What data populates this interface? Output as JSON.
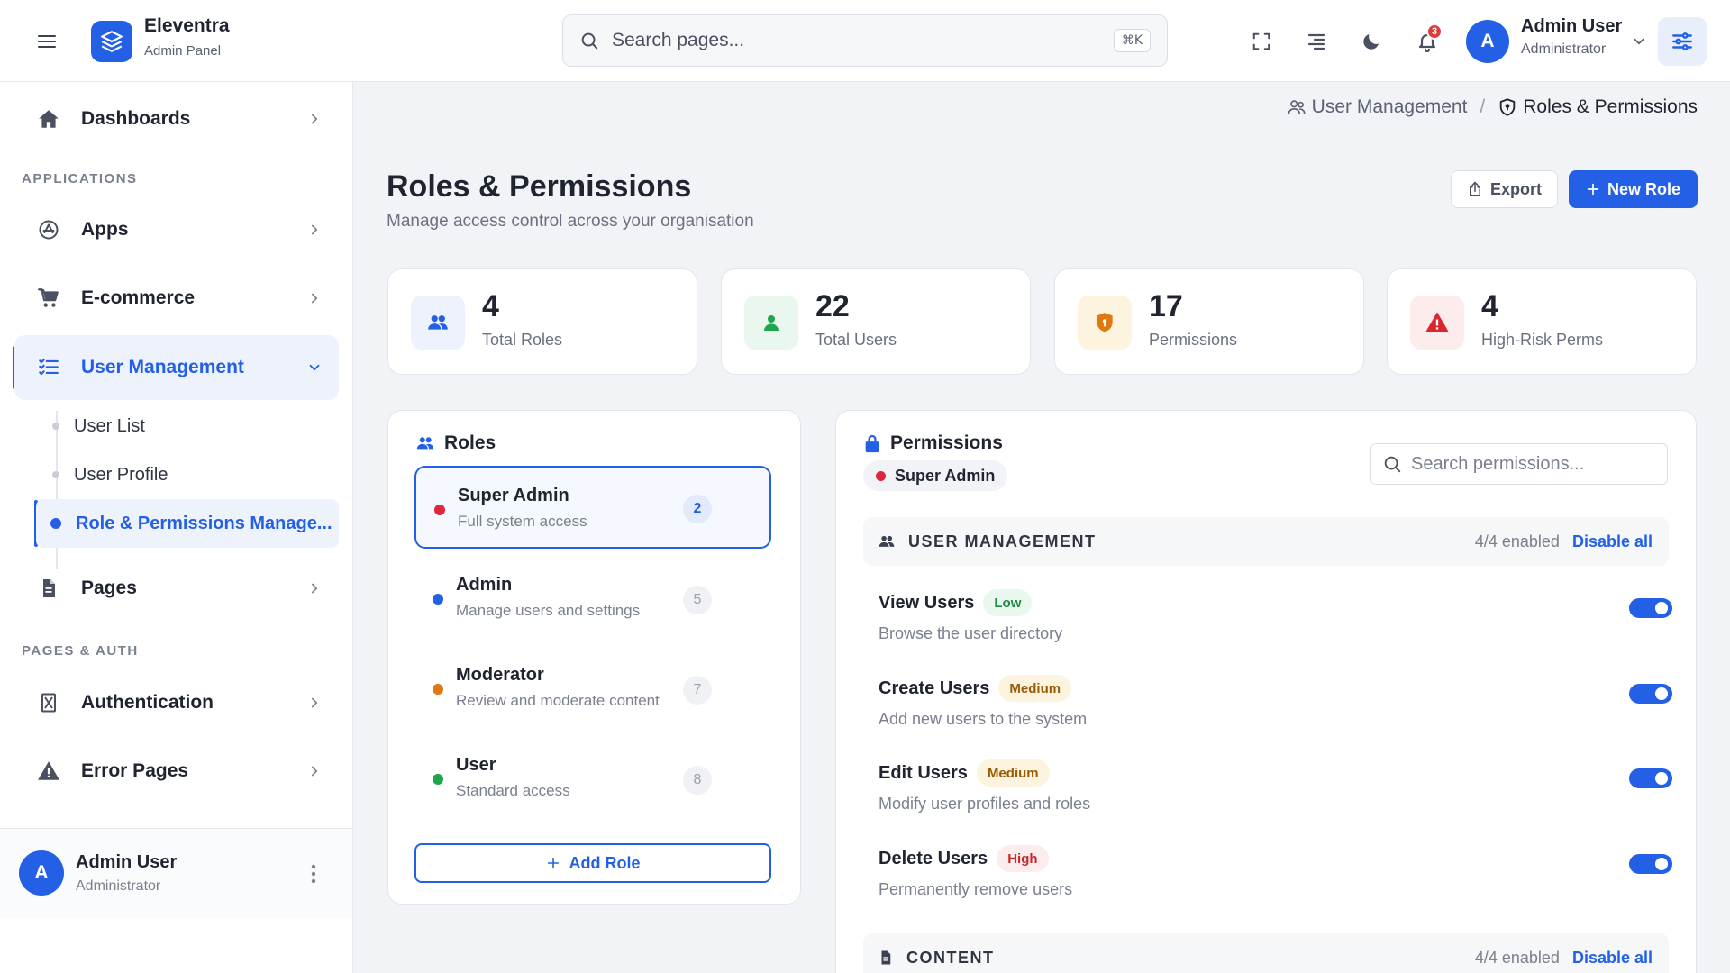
{
  "header": {
    "brand_name": "Eleventra",
    "brand_sub": "Admin Panel",
    "search_placeholder": "Search pages...",
    "search_shortcut": "⌘K",
    "notification_count": "3",
    "user_initial": "A",
    "user_name": "Admin User",
    "user_role": "Administrator"
  },
  "sidebar": {
    "dashboards": "Dashboards",
    "section_applications": "APPLICATIONS",
    "apps": "Apps",
    "ecommerce": "E-commerce",
    "user_management": "User Management",
    "sub_user_list": "User List",
    "sub_user_profile": "User Profile",
    "sub_roles": "Role & Permissions Manage...",
    "pages": "Pages",
    "section_pages_auth": "PAGES & AUTH",
    "authentication": "Authentication",
    "error_pages": "Error Pages",
    "footer_initial": "A",
    "footer_name": "Admin User",
    "footer_role": "Administrator"
  },
  "breadcrumb": {
    "parent": "User Management",
    "separator": "/",
    "current": "Roles & Permissions"
  },
  "page": {
    "title": "Roles & Permissions",
    "subtitle": "Manage access control across your organisation",
    "export_label": "Export",
    "new_role_label": "New Role"
  },
  "stats": [
    {
      "value": "4",
      "label": "Total Roles"
    },
    {
      "value": "22",
      "label": "Total Users"
    },
    {
      "value": "17",
      "label": "Permissions"
    },
    {
      "value": "4",
      "label": "High-Risk Perms"
    }
  ],
  "roles_panel": {
    "title": "Roles",
    "add_label": "Add Role",
    "items": [
      {
        "name": "Super Admin",
        "desc": "Full system access",
        "count": "2",
        "color": "#e0263f"
      },
      {
        "name": "Admin",
        "desc": "Manage users and settings",
        "count": "5",
        "color": "#2360e6"
      },
      {
        "name": "Moderator",
        "desc": "Review and moderate content",
        "count": "7",
        "color": "#e07a10"
      },
      {
        "name": "User",
        "desc": "Standard access",
        "count": "8",
        "color": "#1fa64a"
      }
    ]
  },
  "permissions_panel": {
    "title": "Permissions",
    "selected_role": "Super Admin",
    "search_placeholder": "Search permissions...",
    "groups": [
      {
        "title": "USER MANAGEMENT",
        "count": "4/4 enabled",
        "toggle_label": "Disable all",
        "items": [
          {
            "name": "View Users",
            "risk": "Low",
            "desc": "Browse the user directory",
            "enabled": true
          },
          {
            "name": "Create Users",
            "risk": "Medium",
            "desc": "Add new users to the system",
            "enabled": true
          },
          {
            "name": "Edit Users",
            "risk": "Medium",
            "desc": "Modify user profiles and roles",
            "enabled": true
          },
          {
            "name": "Delete Users",
            "risk": "High",
            "desc": "Permanently remove users",
            "enabled": true
          }
        ]
      },
      {
        "title": "CONTENT",
        "count": "4/4 enabled",
        "toggle_label": "Disable all"
      }
    ]
  },
  "colors": {
    "accent": "#2360e6",
    "risk_low_bg": "#eaf7ee",
    "risk_low_fg": "#1f8a45",
    "risk_medium_bg": "#fdf4e0",
    "risk_medium_fg": "#9a5b06",
    "risk_high_bg": "#fdecec",
    "risk_high_fg": "#c42a2a"
  }
}
